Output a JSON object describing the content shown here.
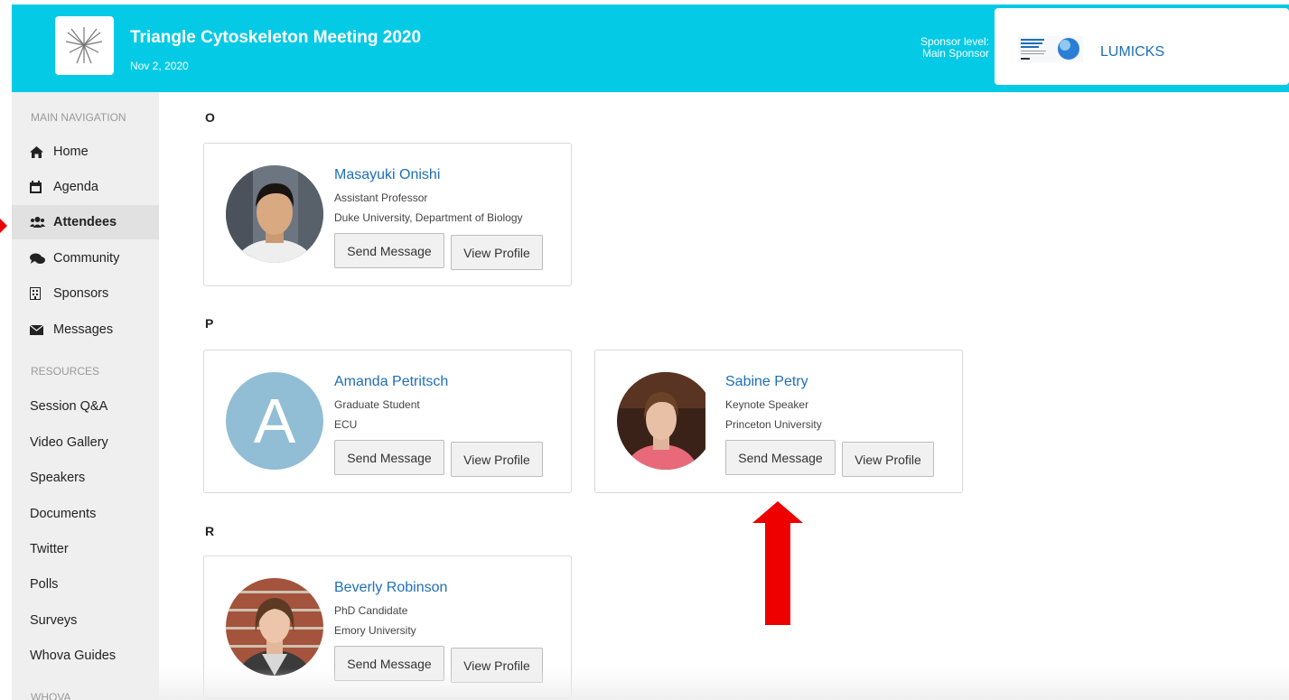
{
  "header": {
    "event_title": "Triangle Cytoskeleton Meeting 2020",
    "event_date": "Nov 2, 2020",
    "sponsor_level_label": "Sponsor level:",
    "sponsor_level_value": "Main Sponsor",
    "sponsor_name": "LUMICKS",
    "brand_color": "#05cae5"
  },
  "sidebar": {
    "main_heading": "MAIN NAVIGATION",
    "main_items": [
      {
        "label": "Home",
        "icon": "home-icon"
      },
      {
        "label": "Agenda",
        "icon": "calendar-icon"
      },
      {
        "label": "Attendees",
        "icon": "users-icon",
        "active": true
      },
      {
        "label": "Community",
        "icon": "comments-icon"
      },
      {
        "label": "Sponsors",
        "icon": "building-icon"
      },
      {
        "label": "Messages",
        "icon": "envelope-icon"
      }
    ],
    "resources_heading": "RESOURCES",
    "resource_items": [
      {
        "label": "Session Q&A"
      },
      {
        "label": "Video Gallery"
      },
      {
        "label": "Speakers"
      },
      {
        "label": "Documents"
      },
      {
        "label": "Twitter"
      },
      {
        "label": "Polls"
      },
      {
        "label": "Surveys"
      },
      {
        "label": "Whova Guides"
      }
    ],
    "whova_heading": "WHOVA"
  },
  "attendees": {
    "groups": [
      {
        "letter": "O",
        "people": [
          {
            "name": "Masayuki Onishi",
            "role": "Assistant Professor",
            "org": "Duke University, Department of Biology"
          }
        ]
      },
      {
        "letter": "P",
        "people": [
          {
            "name": "Amanda Petritsch",
            "role": "Graduate Student",
            "org": "ECU",
            "avatar_letter": "A"
          },
          {
            "name": "Sabine Petry",
            "role": "Keynote Speaker",
            "org": "Princeton University"
          }
        ]
      },
      {
        "letter": "R",
        "people": [
          {
            "name": "Beverly Robinson",
            "role": "PhD Candidate",
            "org": "Emory University"
          }
        ]
      }
    ],
    "send_message_label": "Send Message",
    "view_profile_label": "View Profile",
    "link_color": "#1e6fb8"
  },
  "annotation": {
    "arrow_color": "#ee0000"
  }
}
